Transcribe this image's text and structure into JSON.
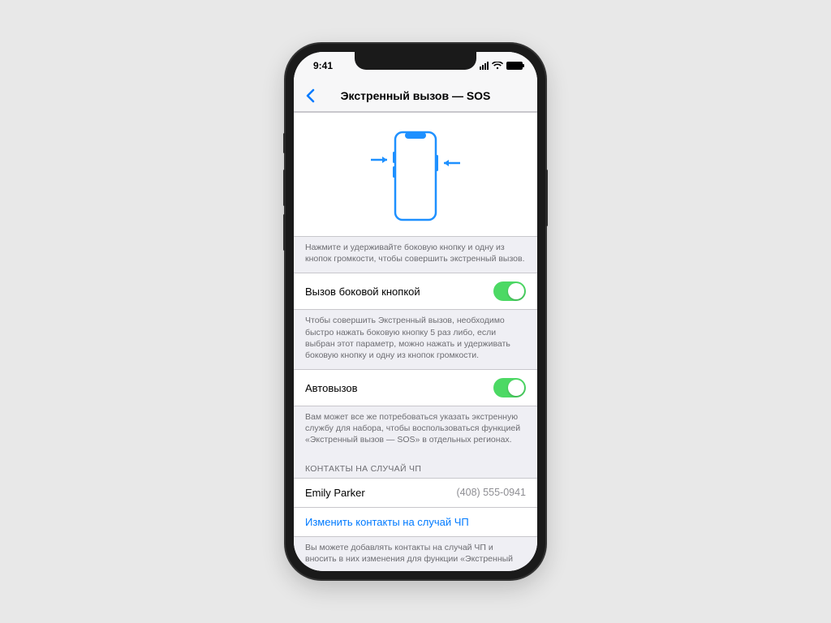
{
  "status": {
    "time": "9:41"
  },
  "nav": {
    "title": "Экстренный вызов — SOS"
  },
  "illustration_footer": "Нажмите и удерживайте боковую кнопку и одну из кнопок громкости, чтобы совершить экстренный вызов.",
  "side_button": {
    "label": "Вызов боковой кнопкой",
    "footer": "Чтобы совершить Экстренный вызов, необходимо быстро нажать боковую кнопку 5 раз либо, если выбран этот параметр, можно нажать и удерживать боковую кнопку и одну из кнопок громкости.",
    "on": true
  },
  "auto_call": {
    "label": "Автовызов",
    "footer": "Вам может все же потребоваться указать экстренную службу для набора, чтобы воспользоваться функцией «Экстренный вызов — SOS» в отдельных регионах.",
    "on": true
  },
  "contacts": {
    "header": "КОНТАКТЫ НА СЛУЧАЙ ЧП",
    "name": "Emily Parker",
    "phone": "(408) 555-0941",
    "edit_label": "Изменить контакты на случай ЧП",
    "footer": "Вы можете добавлять контакты на случай ЧП и вносить в них изменения для функции «Экстренный"
  }
}
